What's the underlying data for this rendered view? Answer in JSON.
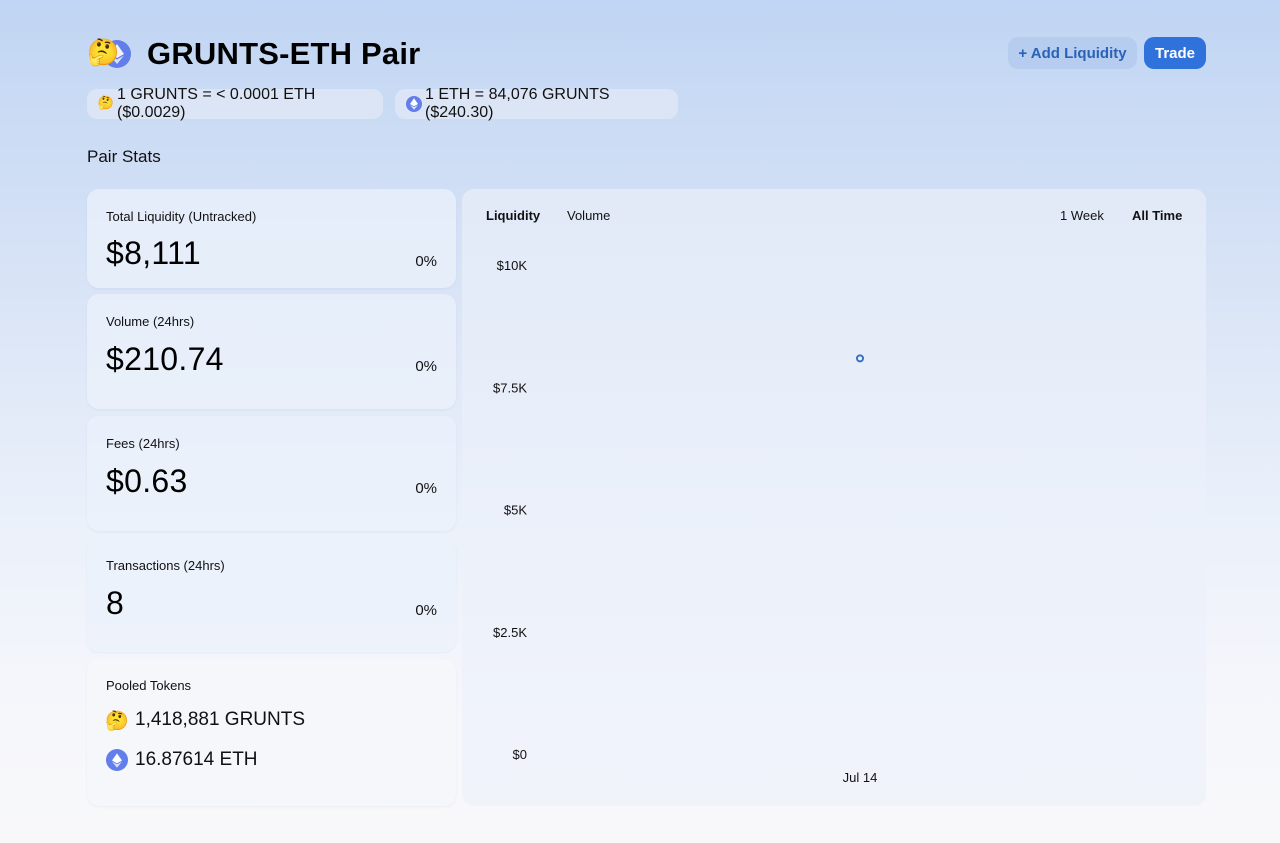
{
  "header": {
    "title": "GRUNTS-ETH Pair",
    "token0_icon": "thinking-face-emoji",
    "token0_glyph": "🤔",
    "token1_icon": "ethereum-icon",
    "add_liquidity_label": "+ Add Liquidity",
    "trade_label": "Trade"
  },
  "prices": {
    "token0_price": "1 GRUNTS = < 0.0001 ETH ($0.0029)",
    "token1_price": "1 ETH = 84,076 GRUNTS ($240.30)"
  },
  "section_title": "Pair Stats",
  "stats": [
    {
      "label": "Total Liquidity (Untracked)",
      "value": "$8,111",
      "change": "0%"
    },
    {
      "label": "Volume (24hrs)",
      "value": "$210.74",
      "change": "0%"
    },
    {
      "label": "Fees (24hrs)",
      "value": "$0.63",
      "change": "0%"
    },
    {
      "label": "Transactions (24hrs)",
      "value": "8",
      "change": "0%"
    }
  ],
  "pooled": {
    "label": "Pooled Tokens",
    "token0": "1,418,881 GRUNTS",
    "token1": "16.87614 ETH"
  },
  "chart_tabs": {
    "liquidity": "Liquidity",
    "volume": "Volume",
    "week": "1 Week",
    "all_time": "All Time"
  },
  "colors": {
    "accent": "#2f72dc",
    "eth": "#627eea",
    "point": "#3b6fbf"
  },
  "chart_data": {
    "type": "scatter",
    "title": "",
    "xlabel": "",
    "ylabel": "",
    "ylim": [
      0,
      10000
    ],
    "yticks": [
      {
        "value": 10000,
        "label": "$10K"
      },
      {
        "value": 7500,
        "label": "$7.5K"
      },
      {
        "value": 5000,
        "label": "$5K"
      },
      {
        "value": 2500,
        "label": "$2.5K"
      },
      {
        "value": 0,
        "label": "$0"
      }
    ],
    "xticks": [
      "Jul 14"
    ],
    "series": [
      {
        "x": [
          "Jul 14"
        ],
        "values": [
          8111
        ]
      }
    ],
    "grid": false
  }
}
